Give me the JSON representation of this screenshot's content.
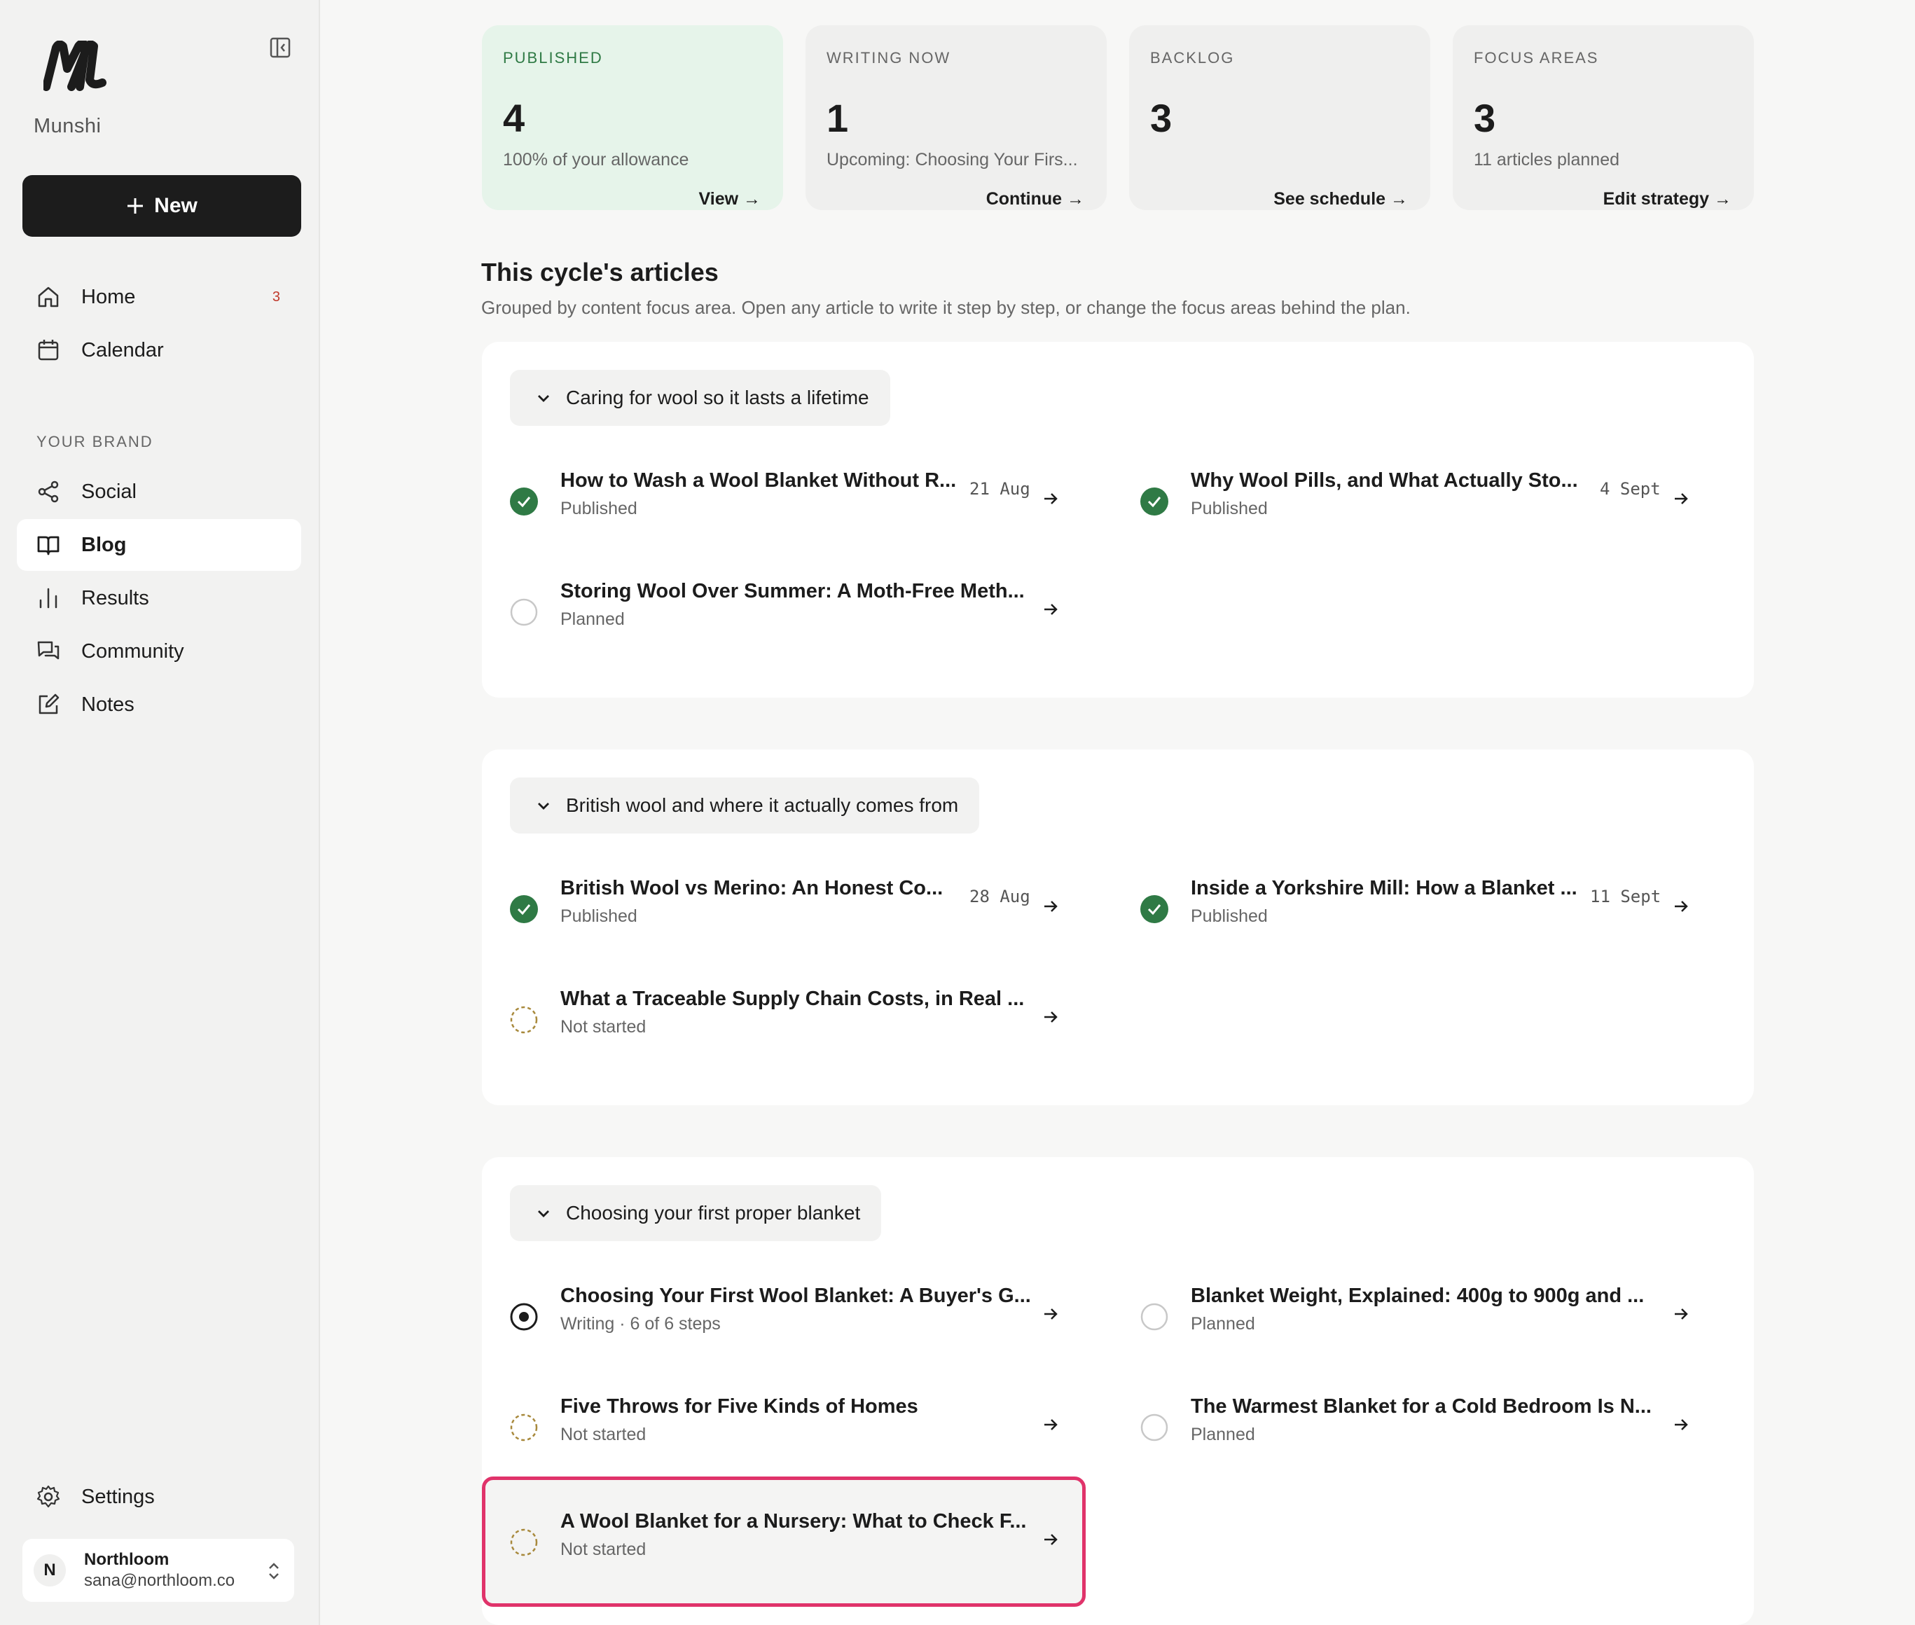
{
  "sidebar": {
    "brand": "Munshi",
    "new_label": "New",
    "nav": [
      {
        "label": "Home",
        "badge": "3",
        "icon": "home-icon"
      },
      {
        "label": "Calendar",
        "icon": "calendar-icon"
      }
    ],
    "section_label": "YOUR BRAND",
    "brand_nav": [
      {
        "label": "Social",
        "icon": "share-icon"
      },
      {
        "label": "Blog",
        "icon": "book-icon",
        "active": true
      },
      {
        "label": "Results",
        "icon": "bar-chart-icon"
      },
      {
        "label": "Community",
        "icon": "chat-icon"
      },
      {
        "label": "Notes",
        "icon": "edit-icon"
      }
    ],
    "settings_label": "Settings",
    "account": {
      "initial": "N",
      "name": "Northloom",
      "email": "sana@northloom.co"
    }
  },
  "stats": [
    {
      "label": "PUBLISHED",
      "value": "4",
      "sub": "100% of your allowance",
      "link": "View →"
    },
    {
      "label": "WRITING NOW",
      "value": "1",
      "sub": "Upcoming: Choosing Your Firs...",
      "link": "Continue →"
    },
    {
      "label": "BACKLOG",
      "value": "3",
      "sub": "",
      "link": "See schedule →"
    },
    {
      "label": "FOCUS AREAS",
      "value": "3",
      "sub": "11 articles planned",
      "link": "Edit strategy →"
    }
  ],
  "main": {
    "heading": "This cycle's articles",
    "subheading": "Grouped by content focus area. Open any article to write it step by step, or change the focus areas behind the plan."
  },
  "groups": [
    {
      "title": "Caring for wool so it lasts a lifetime",
      "articles": [
        {
          "title": "How to Wash a Wool Blanket Without R...",
          "status": "Published",
          "date": "21 Aug"
        },
        {
          "title": "Why Wool Pills, and What Actually Sto...",
          "status": "Published",
          "date": "4 Sept"
        },
        {
          "title": "Storing Wool Over Summer: A Moth-Free Meth...",
          "status": "Planned",
          "date": ""
        }
      ]
    },
    {
      "title": "British wool and where it actually comes from",
      "articles": [
        {
          "title": "British Wool vs Merino: An Honest Co...",
          "status": "Published",
          "date": "28 Aug"
        },
        {
          "title": "Inside a Yorkshire Mill: How a Blanket ...",
          "status": "Published",
          "date": "11 Sept"
        },
        {
          "title": "What a Traceable Supply Chain Costs, in Real ...",
          "status": "Not started",
          "date": ""
        }
      ]
    },
    {
      "title": "Choosing your first proper blanket",
      "articles": [
        {
          "title": "Choosing Your First Wool Blanket: A Buyer's G...",
          "status": "Writing · 6 of 6 steps",
          "date": ""
        },
        {
          "title": "Blanket Weight, Explained: 400g to 900g and ...",
          "status": "Planned",
          "date": ""
        },
        {
          "title": "Five Throws for Five Kinds of Homes",
          "status": "Not started",
          "date": ""
        },
        {
          "title": "The Warmest Blanket for a Cold Bedroom Is N...",
          "status": "Planned",
          "date": ""
        },
        {
          "title": "A Wool Blanket for a Nursery: What to Check F...",
          "status": "Not started",
          "date": ""
        }
      ]
    }
  ],
  "colors": {
    "accent_green": "#2f7a45",
    "highlight": "#e0336a",
    "dark": "#1c1c1c"
  }
}
